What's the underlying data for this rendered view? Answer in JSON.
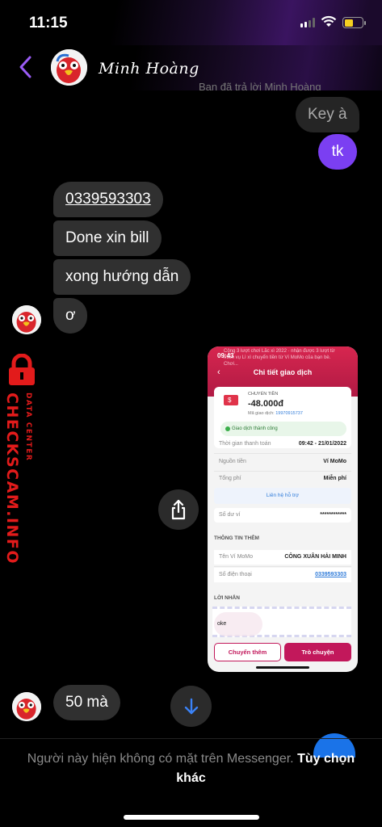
{
  "status_bar": {
    "time": "11:15"
  },
  "header": {
    "contact_name": "Minh Hoàng",
    "faded_text": "Bạn đã trả lời Minh Hoàng"
  },
  "messages": {
    "out_gray": "Key à",
    "out_purple": "tk",
    "in_1": "0339593303",
    "in_2": "Done xin bill",
    "in_3": "xong hướng dẫn",
    "in_4": "ơ",
    "in_5": "50 mà"
  },
  "watermark": {
    "main": "CHECKSCAM.INFO",
    "sub": "DATA CENTER"
  },
  "receipt": {
    "status_time": "09:43",
    "faint_banner": "Cộng 3 lượt chơi Lắc xì 2022 · nhận được 3 lượt từ miễn vụ Lì xì chuyển tiền từ Ví MoMo của bạn bè. Chơi...",
    "title": "Chi tiết giao dịch",
    "type_label": "CHUYỂN TIỀN",
    "amount": "-48.000đ",
    "code_label": "Mã giao dịch:",
    "code": "19970915737",
    "success": "Giao dịch thành công",
    "rows": [
      {
        "k": "Thời gian thanh toán",
        "v": "09:42 - 21/01/2022"
      },
      {
        "k": "Nguồn tiền",
        "v": "Ví MoMo"
      },
      {
        "k": "Tổng phí",
        "v": "Miễn phí"
      }
    ],
    "support": "Liên hệ hỗ trợ",
    "balance_label": "Số dư ví",
    "balance_value": "************",
    "more_info": "THÔNG TIN THÊM",
    "name_label": "Tên Ví MoMo",
    "name_value": "CÔNG XUÂN HẢI MINH",
    "phone_label": "Số điện thoại",
    "phone_value": "0339593303",
    "note_label": "LỜI NHẮN",
    "note_text": "oke",
    "btn_transfer": "Chuyển thêm",
    "btn_chat": "Trò chuyện"
  },
  "footer": {
    "notice": "Người này hiện không có mặt trên Messenger.",
    "options": "Tùy chọn khác"
  }
}
